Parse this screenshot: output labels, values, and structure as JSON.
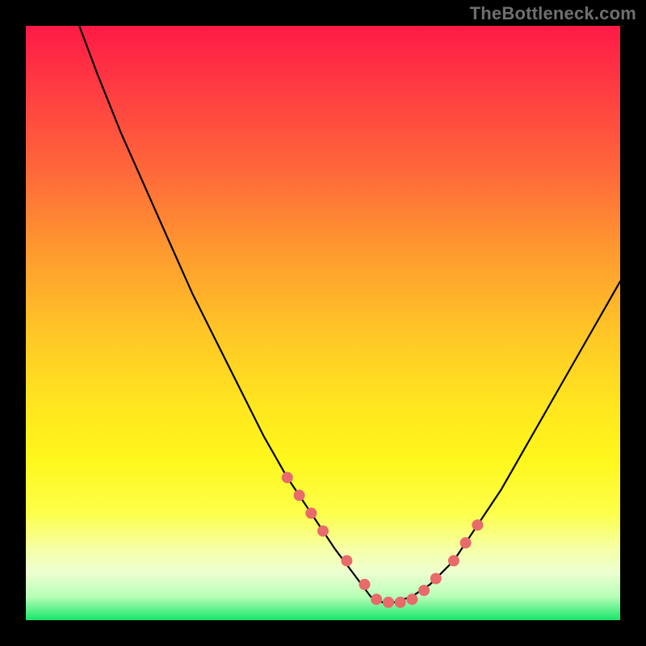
{
  "watermark": "TheBottleneck.com",
  "palette": {
    "gradient_top": "#ff1a46",
    "gradient_mid": "#ffe61f",
    "gradient_bottom": "#19e56a",
    "curve": "#000000",
    "dots": "#e86a6a",
    "frame_bg": "#000000"
  },
  "chart_data": {
    "type": "line",
    "title": "",
    "xlabel": "",
    "ylabel": "",
    "xlim": [
      0,
      100
    ],
    "ylim": [
      0,
      100
    ],
    "grid": false,
    "legend": false,
    "annotations": [],
    "note": "Axes are unlabeled in the source image. x and y are normalized 0–100 (bottom-left origin). The curve is a V/U shape with minimum near x≈60; y≈0 is the green bottom band.",
    "series": [
      {
        "name": "curve",
        "x": [
          9,
          12,
          16,
          20,
          24,
          28,
          32,
          36,
          40,
          44,
          48,
          52,
          55,
          58,
          60,
          62,
          65,
          68,
          72,
          76,
          80,
          84,
          88,
          92,
          96,
          100
        ],
        "y": [
          100,
          92,
          82,
          73,
          64,
          55,
          47,
          39,
          31,
          24,
          18,
          12,
          8,
          4,
          3,
          3,
          4,
          6,
          10,
          16,
          22,
          29,
          36,
          43,
          50,
          57
        ]
      }
    ],
    "dots": {
      "name": "highlighted-points",
      "x": [
        44,
        46,
        48,
        50,
        54,
        57,
        59,
        61,
        63,
        65,
        67,
        69,
        72,
        74,
        76
      ],
      "y": [
        24,
        21,
        18,
        15,
        10,
        6,
        3.5,
        3,
        3,
        3.5,
        5,
        7,
        10,
        13,
        16
      ]
    }
  }
}
